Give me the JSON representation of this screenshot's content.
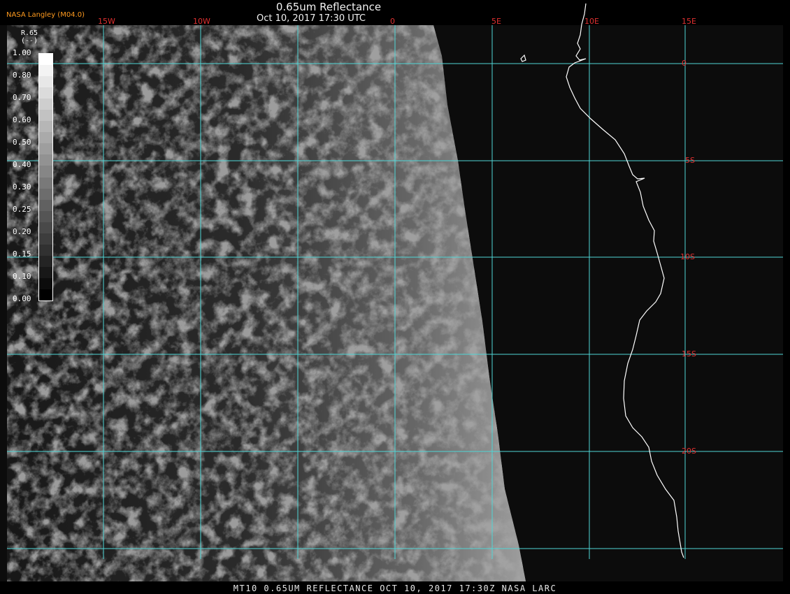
{
  "header": {
    "title": "0.65um Reflectance",
    "subtitle": "Oct 10, 2017 17:30 UTC",
    "branding": "NASA Langley (M04.0)"
  },
  "legend": {
    "title_line1": "R.65",
    "title_line2": "(--)",
    "ticks": [
      "1.00",
      "0.80",
      "0.70",
      "0.60",
      "0.50",
      "0.40",
      "0.30",
      "0.25",
      "0.20",
      "0.15",
      "0.10",
      "0.00"
    ]
  },
  "longitude_labels": [
    "15W",
    "10W",
    "0",
    "5E",
    "10E",
    "15E"
  ],
  "latitude_labels": [
    "0",
    "5S",
    "10S",
    "15S",
    "20S"
  ],
  "footer": "MT10  0.65UM REFLECTANCE   OCT 10, 2017 17:30Z   NASA LARC",
  "colors": {
    "grid": "#4fd6d6",
    "label": "#e03030",
    "branding": "#ff9b1f",
    "coast": "#ffffff"
  }
}
